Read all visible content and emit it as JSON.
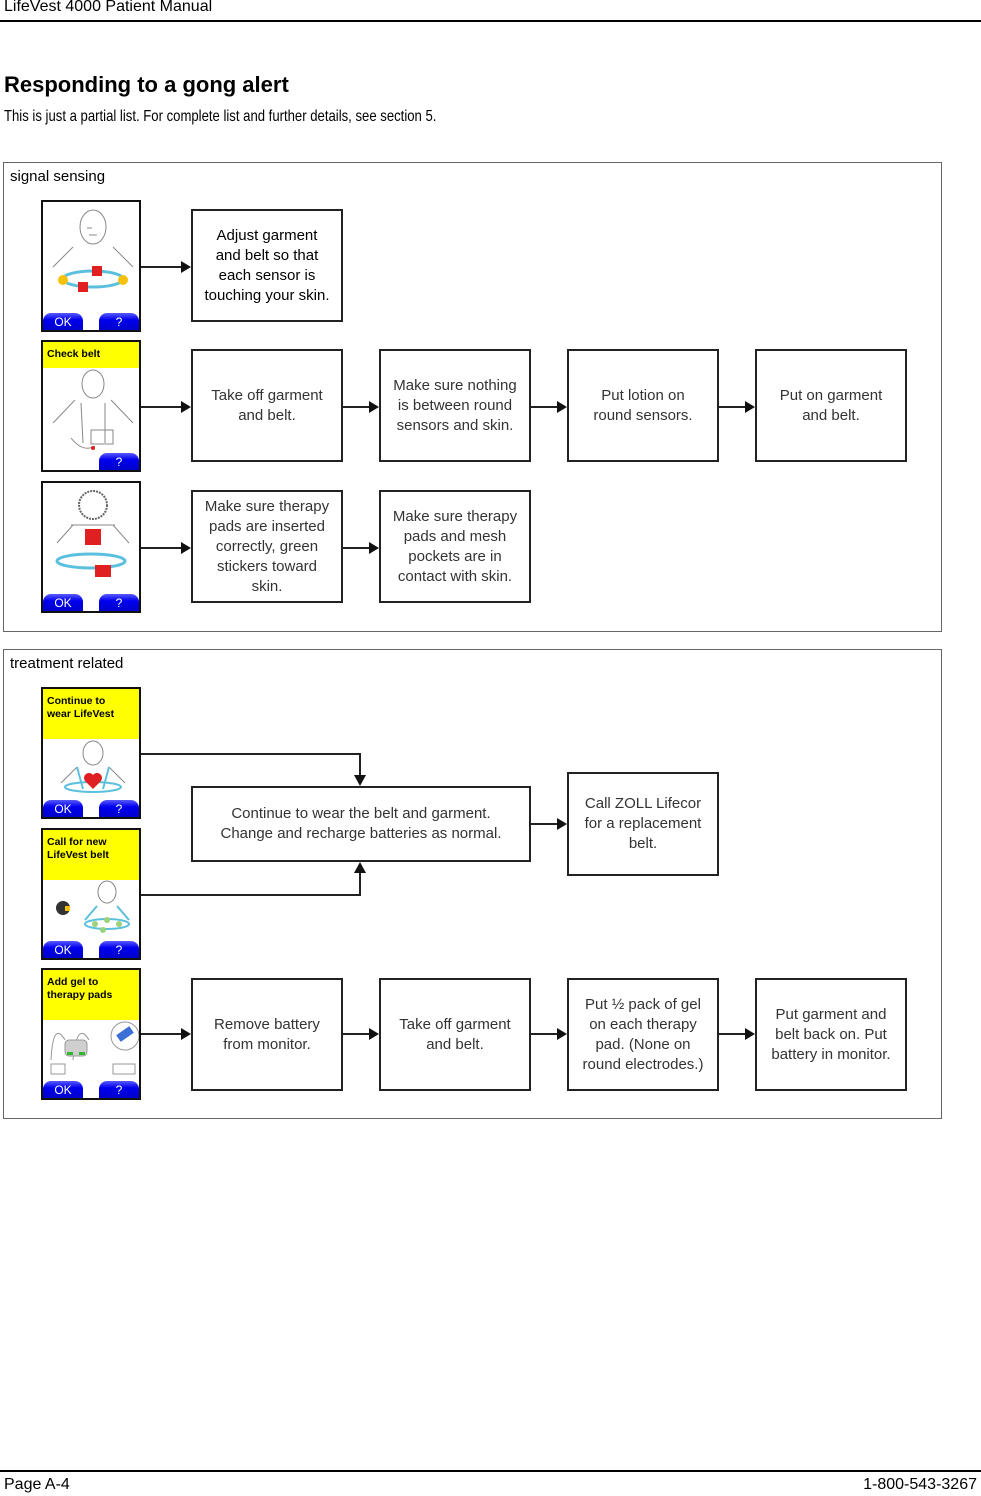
{
  "header": {
    "title": "LifeVest 4000 Patient Manual"
  },
  "page": {
    "heading": "Responding to a gong alert",
    "intro": "This is just a partial list. For complete list and further details, see section 5."
  },
  "panels": {
    "signal": {
      "label": "signal sensing",
      "rows": [
        {
          "screen": {
            "banner": "",
            "ok": "OK",
            "help": "?",
            "icon": "sensors-off-figure"
          },
          "steps": [
            "Adjust garment\nand belt so that\neach sensor is\ntouching your skin."
          ]
        },
        {
          "screen": {
            "banner": "Check belt",
            "ok": "",
            "help": "?",
            "icon": "belt-check-figure"
          },
          "steps": [
            "Take off garment\nand belt.",
            "Make sure nothing\nis between round\nsensors and skin.",
            "Put lotion on\nround sensors.",
            "Put on garment\nand belt."
          ]
        },
        {
          "screen": {
            "banner": "",
            "ok": "OK",
            "help": "?",
            "icon": "therapy-pads-figure"
          },
          "steps": [
            "Make sure therapy\npads are inserted\ncorrectly, green\nstickers toward\nskin.",
            "Make sure therapy\npads and mesh\npockets are in\ncontact with skin."
          ]
        }
      ]
    },
    "treatment": {
      "label": "treatment related",
      "screens": [
        {
          "banner": "Continue to\nwear LifeVest",
          "ok": "OK",
          "help": "?",
          "icon": "heart-figure"
        },
        {
          "banner": "Call for new\nLifeVest belt",
          "ok": "OK",
          "help": "?",
          "icon": "phone-belt-figure"
        },
        {
          "banner": "Add gel to\ntherapy pads",
          "ok": "OK",
          "help": "?",
          "icon": "gel-pads-figure"
        }
      ],
      "merged_steps": [
        "Continue to wear the belt and garment.\nChange and recharge batteries as normal.",
        "Call ZOLL Lifecor\nfor a replacement\nbelt."
      ],
      "gel_steps": [
        "Remove battery\nfrom monitor.",
        "Take off garment\nand belt.",
        "Put ½ pack of gel\non each therapy\npad. (None on\nround electrodes.)",
        "Put garment and\nbelt back on. Put\nbattery in monitor."
      ]
    }
  },
  "footer": {
    "page": "Page A-4",
    "phone": "1-800-543-3267"
  },
  "colors": {
    "banner": "#ffff00",
    "button": "#0000ee",
    "sensor": "#e02020",
    "belt": "#5bc0de"
  }
}
